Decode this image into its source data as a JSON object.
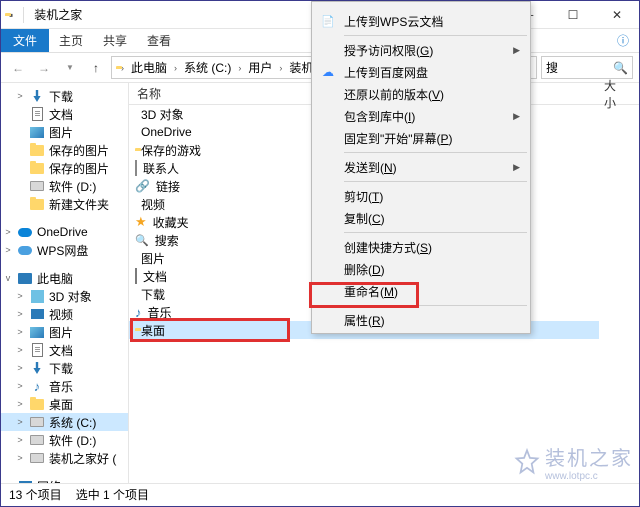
{
  "window": {
    "title": "装机之家"
  },
  "ribbon": {
    "file": "文件",
    "tabs": [
      "主页",
      "共享",
      "查看"
    ]
  },
  "breadcrumb": [
    "此电脑",
    "系统 (C:)",
    "用户",
    "装机之家"
  ],
  "search": {
    "placeholder": "搜"
  },
  "columns": {
    "name": "名称",
    "size": "大小"
  },
  "nav": [
    {
      "label": "下载",
      "icon": "dl",
      "arr": ">"
    },
    {
      "label": "文档",
      "icon": "doc",
      "arr": ""
    },
    {
      "label": "图片",
      "icon": "img",
      "arr": ""
    },
    {
      "label": "保存的图片",
      "icon": "folder",
      "arr": ""
    },
    {
      "label": "保存的图片",
      "icon": "folder",
      "arr": ""
    },
    {
      "label": "软件 (D:)",
      "icon": "disk",
      "arr": ""
    },
    {
      "label": "新建文件夹",
      "icon": "folder",
      "arr": ""
    }
  ],
  "nav2": [
    {
      "label": "OneDrive",
      "icon": "cloud",
      "arr": ">"
    },
    {
      "label": "WPS网盘",
      "icon": "cloudw",
      "arr": ">"
    }
  ],
  "nav3": [
    {
      "label": "此电脑",
      "icon": "pc",
      "arr": "v",
      "lvl": 0
    },
    {
      "label": "3D 对象",
      "icon": "3d",
      "arr": ">",
      "lvl": 1
    },
    {
      "label": "视频",
      "icon": "video",
      "arr": ">",
      "lvl": 1
    },
    {
      "label": "图片",
      "icon": "img",
      "arr": ">",
      "lvl": 1
    },
    {
      "label": "文档",
      "icon": "doc",
      "arr": ">",
      "lvl": 1
    },
    {
      "label": "下载",
      "icon": "dl",
      "arr": ">",
      "lvl": 1
    },
    {
      "label": "音乐",
      "icon": "music",
      "arr": ">",
      "lvl": 1
    },
    {
      "label": "桌面",
      "icon": "folder",
      "arr": ">",
      "lvl": 1
    },
    {
      "label": "系统 (C:)",
      "icon": "disk",
      "arr": ">",
      "lvl": 1,
      "sel": true
    },
    {
      "label": "软件 (D:)",
      "icon": "disk",
      "arr": ">",
      "lvl": 1
    },
    {
      "label": "装机之家好 (",
      "icon": "disk",
      "arr": ">",
      "lvl": 1
    }
  ],
  "nav4": [
    {
      "label": "网络",
      "icon": "net",
      "arr": ">"
    }
  ],
  "files": [
    {
      "label": "3D 对象",
      "icon": "3d"
    },
    {
      "label": "OneDrive",
      "icon": "cloud"
    },
    {
      "label": "保存的游戏",
      "icon": "folder"
    },
    {
      "label": "联系人",
      "icon": "contact"
    },
    {
      "label": "链接",
      "icon": "link"
    },
    {
      "label": "视频",
      "icon": "video"
    },
    {
      "label": "收藏夹",
      "icon": "fav"
    },
    {
      "label": "搜索",
      "icon": "search"
    },
    {
      "label": "图片",
      "icon": "img"
    },
    {
      "label": "文档",
      "icon": "doc"
    },
    {
      "label": "下载",
      "icon": "dl"
    },
    {
      "label": "音乐",
      "icon": "music"
    },
    {
      "label": "桌面",
      "icon": "folder",
      "sel": true
    }
  ],
  "ctx": [
    {
      "label": "上传到WPS云文档",
      "icon": "wps"
    },
    {
      "sep": true
    },
    {
      "label": "授予访问权限(G)",
      "sub": true,
      "u": "G"
    },
    {
      "label": "上传到百度网盘",
      "icon": "baidu"
    },
    {
      "label": "还原以前的版本(V)",
      "u": "V"
    },
    {
      "label": "包含到库中(I)",
      "sub": true,
      "u": "I"
    },
    {
      "label": "固定到\"开始\"屏幕(P)",
      "u": "P"
    },
    {
      "sep": true
    },
    {
      "label": "发送到(N)",
      "sub": true,
      "u": "N"
    },
    {
      "sep": true
    },
    {
      "label": "剪切(T)",
      "u": "T"
    },
    {
      "label": "复制(C)",
      "u": "C"
    },
    {
      "sep": true
    },
    {
      "label": "创建快捷方式(S)",
      "u": "S"
    },
    {
      "label": "删除(D)",
      "u": "D"
    },
    {
      "label": "重命名(M)",
      "u": "M"
    },
    {
      "sep": true
    },
    {
      "label": "属性(R)",
      "u": "R"
    }
  ],
  "status": {
    "count": "13 个项目",
    "selected": "选中 1 个项目"
  },
  "watermark": {
    "text": "装机之家",
    "url": "www.lotpc.c"
  }
}
